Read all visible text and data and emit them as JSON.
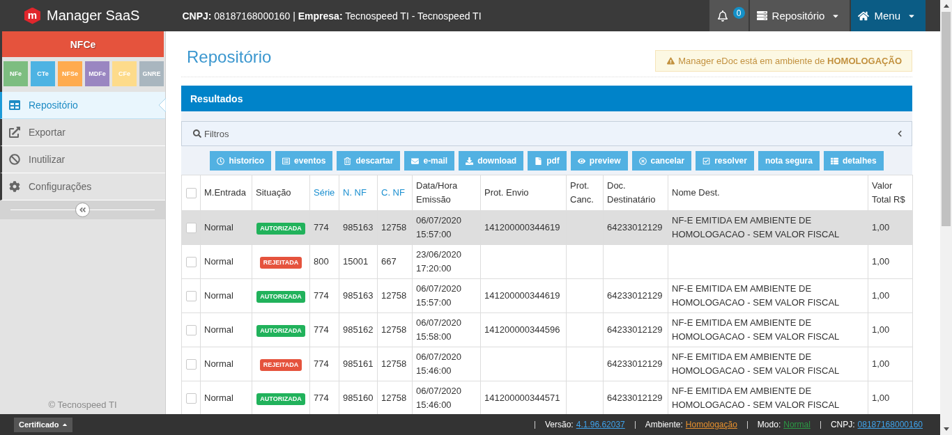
{
  "topbar": {
    "logo": "m",
    "brand": "Manager SaaS",
    "company": "**CNPJ:** 08187168000160 | **Empresa:** Tecnospeed TI - Tecnospeed TI",
    "nav": [
      {
        "kind": "notifications",
        "count": "0"
      },
      {
        "kind": "module",
        "label": "Repositório"
      },
      {
        "kind": "home",
        "label": "Menu"
      }
    ]
  },
  "sidebar": {
    "product": "NFCe",
    "doc_types": [
      {
        "label": "NFe",
        "color": "#7dbd80"
      },
      {
        "label": "CTe",
        "color": "#4db3e3"
      },
      {
        "label": "NFSe",
        "color": "#ffab4f"
      },
      {
        "label": "MDFe",
        "color": "#9a86c1"
      },
      {
        "label": "CFe",
        "color": "#fddb8b"
      },
      {
        "label": "GNRE",
        "color": "#a9b6bf"
      }
    ],
    "items": [
      {
        "kind": "table",
        "label": "Repositório",
        "selected": true
      },
      {
        "kind": "export",
        "label": "Exportar",
        "selected": false
      },
      {
        "kind": "block",
        "label": "Inutilizar",
        "selected": false
      },
      {
        "kind": "settings",
        "label": "Configurações",
        "selected": false
      }
    ],
    "footer": "© Tecnospeed TI"
  },
  "page": {
    "title": "Repositório",
    "alert": "Manager eDoc está em ambiente de **HOMOLOGAÇÃO**"
  },
  "panel": {
    "title": "Resultados",
    "filters": "Filtros",
    "actions": [
      {
        "kind": "history",
        "label": "historico"
      },
      {
        "kind": "events",
        "label": "eventos"
      },
      {
        "kind": "discard",
        "label": "descartar"
      },
      {
        "kind": "email",
        "label": "e-mail"
      },
      {
        "kind": "download",
        "label": "download"
      },
      {
        "kind": "pdf",
        "label": "pdf"
      },
      {
        "kind": "preview",
        "label": "preview"
      },
      {
        "kind": "cancel",
        "label": "cancelar"
      },
      {
        "kind": "resolve",
        "label": "resolver"
      },
      {
        "kind": "plain",
        "label": "nota segura"
      },
      {
        "kind": "details",
        "label": "detalhes"
      }
    ]
  },
  "table": {
    "select_all": {
      "checked": false
    },
    "columns": [
      {
        "label": "M.Entrada",
        "sortable": false
      },
      {
        "label": "Situação",
        "sortable": false
      },
      {
        "label": "Série",
        "sortable": true
      },
      {
        "label": "N. NF",
        "sortable": true
      },
      {
        "label": "C. NF",
        "sortable": true
      },
      {
        "label": "Data/Hora Emissão",
        "sortable": false
      },
      {
        "label": "Prot. Envio",
        "sortable": false
      },
      {
        "label": "Prot. Canc.",
        "sortable": false
      },
      {
        "label": "Doc. Destinatário",
        "sortable": false
      },
      {
        "label": "Nome Dest.",
        "sortable": false
      },
      {
        "label": "Valor Total R$",
        "sortable": false
      }
    ],
    "rows": [
      {
        "checked": false,
        "highlighted": true,
        "entry": "Normal",
        "status": {
          "label": "AUTORIZADA",
          "color": "#21b25b"
        },
        "serie": "774",
        "number": "985163",
        "code": "12758",
        "issued": "06/07/2020 15:57:00",
        "protocol": "141200000344619",
        "recipient_doc": "64233012129",
        "recipient_name": "NF-E EMITIDA EM AMBIENTE DE HOMOLOGACAO - SEM VALOR FISCAL",
        "total": "1,00"
      },
      {
        "checked": false,
        "highlighted": false,
        "entry": "Normal",
        "status": {
          "label": "REJEITADA",
          "color": "#e5533d"
        },
        "serie": "800",
        "number": "15001",
        "code": "667",
        "issued": "23/06/2020 17:20:00",
        "total": "1,00"
      },
      {
        "checked": false,
        "highlighted": false,
        "entry": "Normal",
        "status": {
          "label": "AUTORIZADA",
          "color": "#21b25b"
        },
        "serie": "774",
        "number": "985163",
        "code": "12758",
        "issued": "06/07/2020 15:57:00",
        "protocol": "141200000344619",
        "recipient_doc": "64233012129",
        "recipient_name": "NF-E EMITIDA EM AMBIENTE DE HOMOLOGACAO - SEM VALOR FISCAL",
        "total": "1,00"
      },
      {
        "checked": false,
        "highlighted": false,
        "entry": "Normal",
        "status": {
          "label": "AUTORIZADA",
          "color": "#21b25b"
        },
        "serie": "774",
        "number": "985162",
        "code": "12758",
        "issued": "06/07/2020 15:58:00",
        "protocol": "141200000344596",
        "recipient_doc": "64233012129",
        "recipient_name": "NF-E EMITIDA EM AMBIENTE DE HOMOLOGACAO - SEM VALOR FISCAL",
        "total": "1,00"
      },
      {
        "checked": false,
        "highlighted": false,
        "entry": "Normal",
        "status": {
          "label": "REJEITADA",
          "color": "#e5533d"
        },
        "serie": "774",
        "number": "985161",
        "code": "12758",
        "issued": "06/07/2020 15:46:00",
        "recipient_doc": "64233012129",
        "recipient_name": "NF-E EMITIDA EM AMBIENTE DE HOMOLOGACAO - SEM VALOR FISCAL",
        "total": "1,00"
      },
      {
        "checked": false,
        "highlighted": false,
        "entry": "Normal",
        "status": {
          "label": "AUTORIZADA",
          "color": "#21b25b"
        },
        "serie": "774",
        "number": "985160",
        "code": "12758",
        "issued": "06/07/2020 15:46:00",
        "protocol": "141200000344571",
        "recipient_doc": "64233012129",
        "recipient_name": "NF-E EMITIDA EM AMBIENTE DE HOMOLOGACAO - SEM VALOR FISCAL",
        "total": "1,00"
      }
    ]
  },
  "status_bar": {
    "certificate": "Certificado",
    "items": [
      {
        "label": "Versão:",
        "value": "4.1.96.62037",
        "color": "#3fa3ec"
      },
      {
        "label": "Ambiente:",
        "value": "Homologação",
        "color": "#e8912e"
      },
      {
        "label": "Modo:",
        "value": "Normal",
        "color": "#2b9a45"
      },
      {
        "label": "CNPJ:",
        "value": "08187168000160",
        "color": "#3fa3ec"
      }
    ]
  }
}
